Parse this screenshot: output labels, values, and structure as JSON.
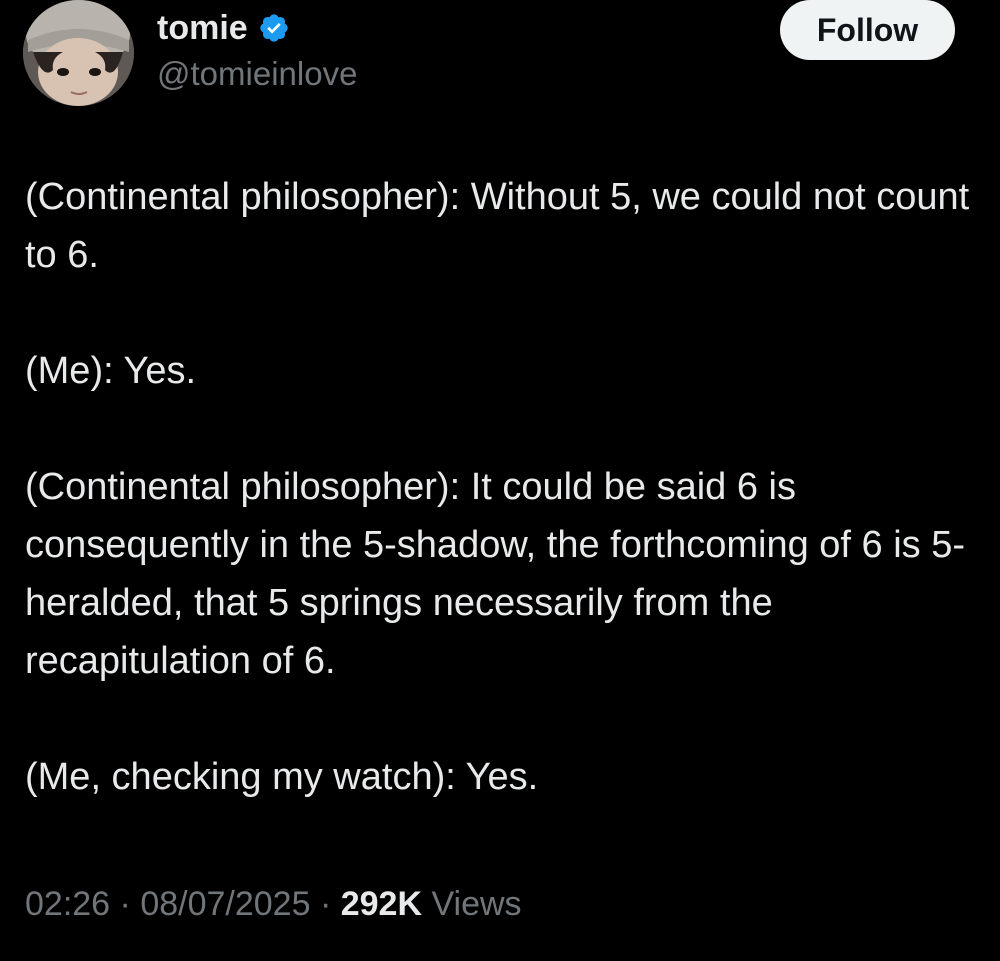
{
  "author": {
    "display_name": "tomie",
    "handle": "@tomieinlove",
    "verified": true,
    "verified_color": "#1d9bf0"
  },
  "actions": {
    "follow_label": "Follow"
  },
  "tweet": {
    "paragraphs": [
      "(Continental philosopher): Without 5, we could not count to 6.",
      "(Me): Yes.",
      "(Continental philosopher): It could be said 6 is consequently in the 5-shadow, the forthcoming of 6 is 5-heralded, that 5 springs necessarily from the recapitulation of 6.",
      "(Me, checking my watch): Yes."
    ]
  },
  "meta": {
    "time": "02:26",
    "separator": "·",
    "date": "08/07/2025",
    "views_count": "292K",
    "views_label": "Views"
  },
  "colors": {
    "background": "#000000",
    "text_primary": "#e7e9ea",
    "text_secondary": "#71767b",
    "button_bg": "#eff3f4"
  }
}
